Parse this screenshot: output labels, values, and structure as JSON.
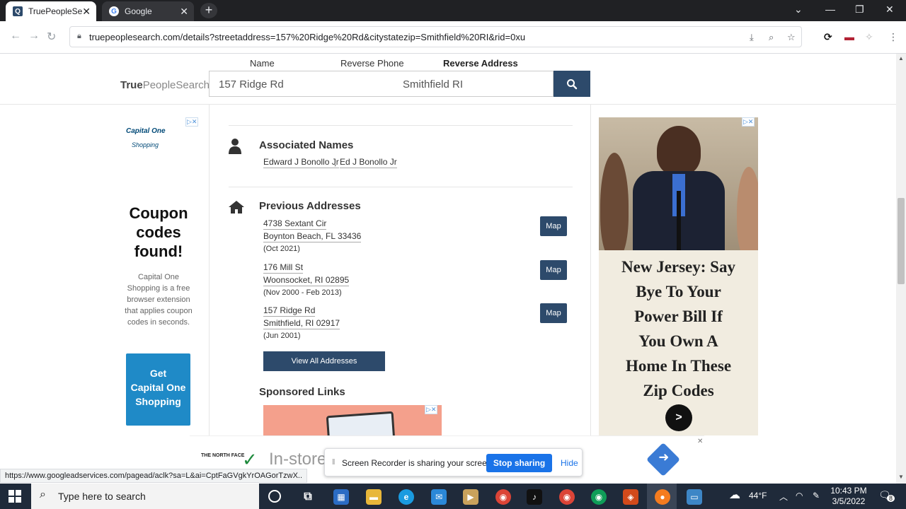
{
  "browser": {
    "tabs": [
      {
        "title": "TruePeopleSe",
        "active": true
      },
      {
        "title": "Google",
        "active": false
      }
    ],
    "new_tab": "+",
    "url": "truepeoplesearch.com/details?streetaddress=157%20Ridge%20Rd&citystatezip=Smithfield%20RI&rid=0xu",
    "status_url": "https://www.googleadservices.com/pagead/aclk?sa=L&ai=CptFaGVgkYrOAGorTzwX..",
    "window_controls": {
      "minimize": "—",
      "restore": "❐",
      "close": "✕"
    },
    "nav": {
      "back": "←",
      "forward": "→",
      "reload": "↻"
    }
  },
  "site": {
    "brand_true": "True",
    "brand_rest": "PeopleSearch",
    "search_tabs": [
      "Name",
      "Reverse Phone",
      "Reverse Address"
    ],
    "active_search_tab": "Reverse Address",
    "search": {
      "street": "157 Ridge Rd",
      "citystate": "Smithfield RI"
    }
  },
  "left_ad": {
    "logo": "Capital One",
    "logo_sub": "Shopping",
    "headline_lines": [
      "Coupon",
      "codes",
      "found!"
    ],
    "body": "Capital One Shopping is a free browser extension that applies coupon codes in seconds.",
    "button_lines": [
      "Get",
      "Capital One",
      "Shopping"
    ]
  },
  "associated_names": {
    "title": "Associated Names",
    "names": [
      "Edward J Bonollo Jr",
      "Ed J Bonollo Jr"
    ],
    "separator": ","
  },
  "previous_addresses": {
    "title": "Previous Addresses",
    "items": [
      {
        "street": "4738 Sextant Cir",
        "city": "Boynton Beach, FL 33436",
        "dates": "(Oct 2021)",
        "map_label": "Map"
      },
      {
        "street": "176 Mill St",
        "city": "Woonsocket, RI 02895",
        "dates": "(Nov 2000 - Feb 2013)",
        "map_label": "Map"
      },
      {
        "street": "157 Ridge Rd",
        "city": "Smithfield, RI 02917",
        "dates": "(Jun 2001)",
        "map_label": "Map"
      }
    ],
    "view_all": "View All Addresses"
  },
  "sponsored": {
    "title": "Sponsored Links"
  },
  "right_ad": {
    "headline_lines": [
      "New Jersey: Say",
      "Bye To Your",
      "Power Bill If",
      "You Own A",
      "Home In These",
      "Zip Codes"
    ]
  },
  "bottom_banner": {
    "logo": "THE NORTH FACE",
    "text": "In-store"
  },
  "share_bar": {
    "message": "Screen Recorder is sharing your screen.",
    "stop": "Stop sharing",
    "hide": "Hide"
  },
  "taskbar": {
    "search_placeholder": "Type here to search",
    "weather": "44°F",
    "time": "10:43 PM",
    "date": "3/5/2022",
    "notifications": "8"
  },
  "colors": {
    "nav_blue": "#2d4a6b",
    "share_blue": "#1a73e8",
    "coupon_blue": "#1f8ac7"
  }
}
